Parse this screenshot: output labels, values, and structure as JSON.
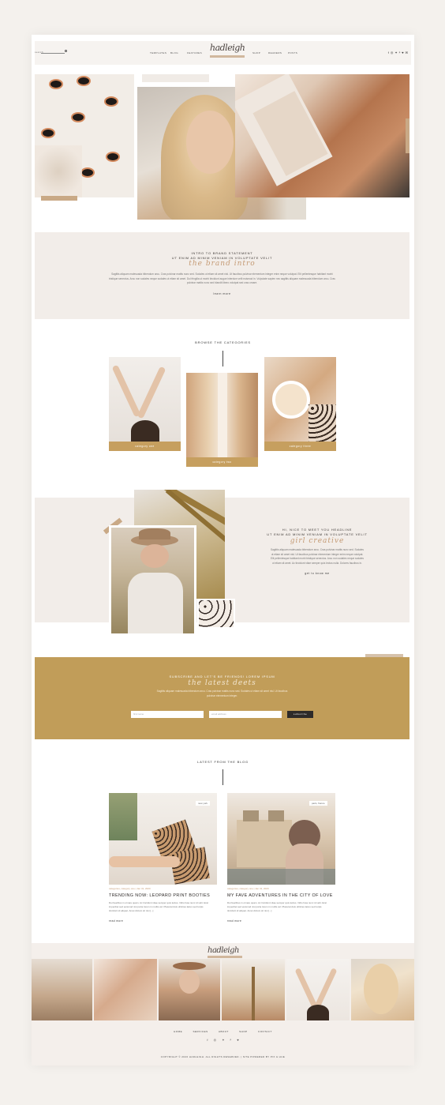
{
  "nav": {
    "search_label": "search",
    "links_left": [
      "TEMPLATES",
      "BLOG",
      "FEATURES"
    ],
    "links_right": [
      "SHOP",
      "READERS",
      "POSTS"
    ],
    "logo": "hadleigh",
    "social_icons": [
      "facebook-icon",
      "instagram-icon",
      "twitter-icon",
      "pinterest-icon",
      "heart-icon",
      "email-icon"
    ]
  },
  "intro": {
    "kicker1": "INTRO TO BRAND STATEMENT",
    "kicker2": "UT ENIM AD MINIM VENIAM IN VOLUPTATE VELIT",
    "script": "the brand intro",
    "body": "Sagittis aliquam malesuada bibendum arcu. Cras pulvinar mattis nunc sed. Sodales ut etiam sit amet nisl. Ut faucibus pulvinar elementum integer enim neque volutpat. Elit pellentesque habitant morbi tristique senectus. Arcu non sodales neque sodales ut etiam sit amet. Dui fringilla ut morbi tincidunt augue interdum velit euismod in. Vulputate sapien nec sagittis aliquam malesuada bibendum arcu. Cras pulvinar mattis nunc sed blandit libero volutpat sed cras ornare.",
    "cta": "learn more"
  },
  "categories": {
    "title": "BROWSE THE CATEGORIES",
    "items": [
      {
        "label": "category one"
      },
      {
        "label": "category two"
      },
      {
        "label": "category three"
      }
    ]
  },
  "about": {
    "kicker1": "HI, NICE TO MEET YOU HEADLINE",
    "kicker2": "UT ENIM AD MINIM VENIAM IN VOLUPTATE VELIT",
    "script": "girl creative",
    "body": "Sagittis aliquam malesuada bibendum arcu. Cras pulvinar mattis nunc sed. Sodales ut etiam sit amet nisl. Ut faucibus pulvinar elementum integer enim neque volutpat. Elit pellentesque habitant morbi tristique senectus. Arcu non sodales neque sodales ut etiam sit amet. Ac tincidunt vitae semper quis lectus nulla. Dolores faucibus in.",
    "cta": "get to know me"
  },
  "subscribe": {
    "kicker": "SUBSCRIBE AND LET'S BE FRIENDS! LOREM IPSUM",
    "script": "the latest deets",
    "body": "Sagittis aliquam malesuada bibendum arcu. Cras pulvinar mattis nunc sed. Sodales ut etiam sit amet nisl. Ut faucibus pulvinar elementum integer.",
    "name_placeholder": "first name",
    "email_placeholder": "email address",
    "button": "subscribe"
  },
  "blog": {
    "title": "LATEST FROM THE BLOG",
    "posts": [
      {
        "location": "new york",
        "meta": "categories, category one | Jan 31, 2020",
        "title": "TRENDING NOW: LEOPARD PRINT BOOTIES",
        "excerpt": "Dui faucibus in ornare quam. Ac tincidunt vitae semper quis lectus. Odio fusa nunc id velit. Erat imperdiet sed euismod nisi porta lorem in mollis vel. Placerat duis ultricies lacus sed turpis tincidunt id aliquet. Amet dictum sit nisi [...]",
        "cta": "read more"
      },
      {
        "location": "paris, france",
        "meta": "categories, category one | Jan 31, 2020",
        "title": "MY FAVE ADVENTURES IN THE CITY OF LOVE",
        "excerpt": "Dui faucibus in ornare quam. Ac tincidunt vitae semper quis lectus. Odio fusa nunc id velit. Erat imperdiet sed euismod nisi porta lorem in mollis vel. Placerat duis ultricies lacus sed turpis tincidunt id aliquet. Amet dictum sit nisi [...]",
        "cta": "read more"
      }
    ]
  },
  "footer": {
    "logo": "hadleigh",
    "links": [
      "HOME",
      "SERVICES",
      "ABOUT",
      "SHOP",
      "CONTACT"
    ],
    "social_icons": [
      "facebook-icon",
      "instagram-icon",
      "twitter-icon",
      "pinterest-icon",
      "heart-icon"
    ],
    "copyright": "COPYRIGHT © 2020 HADLEIGH. ALL RIGHTS RESERVED. | SITE POWERED BY PIX & HUE"
  },
  "colors": {
    "accent_gold": "#c19d59",
    "blush_bg": "#f2ede9",
    "script_tan": "#c49a74"
  }
}
